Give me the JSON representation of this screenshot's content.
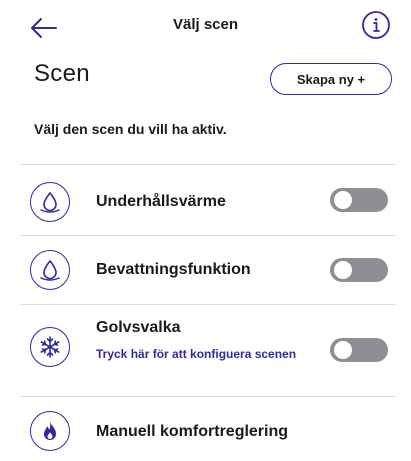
{
  "header": {
    "title": "Välj scen"
  },
  "section": {
    "title": "Scen",
    "create_label": "Skapa ny +",
    "description": "Välj den scen du vill ha aktiv."
  },
  "scenes": [
    {
      "label": "Underhållsvärme",
      "icon": "water-drop-icon",
      "enabled": false
    },
    {
      "label": "Bevattningsfunktion",
      "icon": "water-drop-icon",
      "enabled": false
    },
    {
      "label": "Golvsvalka",
      "subtitle": "Tryck här för att konfiguera scenen",
      "icon": "snowflake-icon",
      "enabled": false
    },
    {
      "label": "Manuell komfortreglering",
      "icon": "flame-icon"
    }
  ],
  "colors": {
    "accent": "#2e2aa0",
    "toggle_off": "#8e8e95",
    "divider": "#dcdcdc"
  }
}
